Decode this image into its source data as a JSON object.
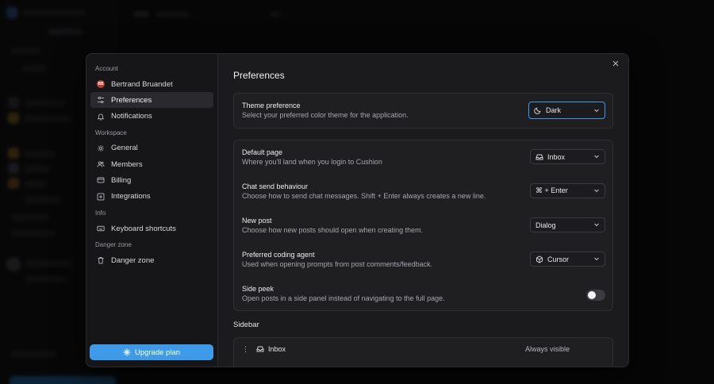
{
  "settings_nav": {
    "sections": [
      {
        "label": "Account",
        "items": [
          {
            "label": "Bertrand Bruandet",
            "icon": "avatar",
            "avatar_initials": "BB"
          },
          {
            "label": "Preferences",
            "icon": "sliders-icon",
            "active": true
          },
          {
            "label": "Notifications",
            "icon": "bell-icon"
          }
        ]
      },
      {
        "label": "Workspace",
        "items": [
          {
            "label": "General",
            "icon": "gear-icon"
          },
          {
            "label": "Members",
            "icon": "users-icon"
          },
          {
            "label": "Billing",
            "icon": "credit-card-icon"
          },
          {
            "label": "Integrations",
            "icon": "plus-square-icon"
          }
        ]
      },
      {
        "label": "Info",
        "items": [
          {
            "label": "Keyboard shortcuts",
            "icon": "keyboard-icon"
          }
        ]
      },
      {
        "label": "Danger zone",
        "items": [
          {
            "label": "Danger zone",
            "icon": "trash-icon"
          }
        ]
      }
    ],
    "upgrade_label": "Upgrade plan"
  },
  "content": {
    "title": "Preferences",
    "theme": {
      "title": "Theme preference",
      "description": "Select your preferred color theme for the application.",
      "value": "Dark",
      "icon": "moon-icon"
    },
    "default_page": {
      "title": "Default page",
      "description": "Where you'll land when you login to Cushion",
      "value": "Inbox",
      "icon": "inbox-icon"
    },
    "chat_send": {
      "title": "Chat send behaviour",
      "description": "Choose how to send chat messages. Shift + Enter always creates a new line.",
      "value": "⌘ + Enter"
    },
    "new_post": {
      "title": "New post",
      "description": "Choose how new posts should open when creating them.",
      "value": "Dialog"
    },
    "coding_agent": {
      "title": "Preferred coding agent",
      "description": "Used when opening prompts from post comments/feedback.",
      "value": "Cursor",
      "icon": "cube-icon"
    },
    "side_peek": {
      "title": "Side peek",
      "description": "Open posts in a side panel instead of navigating to the full page.",
      "enabled": false
    },
    "sidebar": {
      "heading": "Sidebar",
      "items": [
        {
          "label": "Inbox",
          "visibility": "Always visible",
          "icon": "inbox-icon"
        }
      ]
    }
  },
  "colors": {
    "accent": "#3d9be9",
    "background": "#1b1b1d",
    "nav_background": "#161618"
  }
}
